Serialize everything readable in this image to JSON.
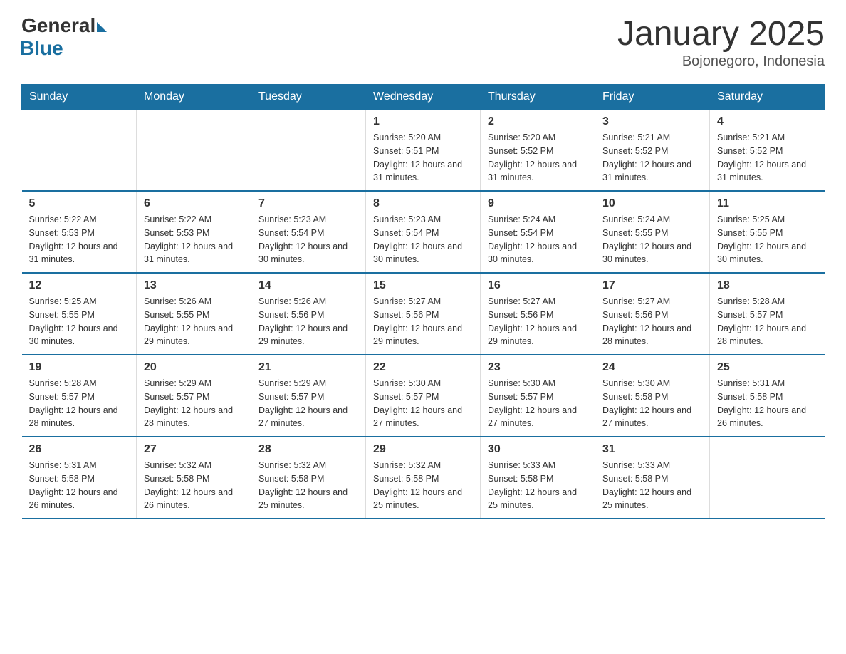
{
  "header": {
    "logo_general": "General",
    "logo_blue": "Blue",
    "month_year": "January 2025",
    "location": "Bojonegoro, Indonesia"
  },
  "days_of_week": [
    "Sunday",
    "Monday",
    "Tuesday",
    "Wednesday",
    "Thursday",
    "Friday",
    "Saturday"
  ],
  "weeks": [
    [
      {
        "day": "",
        "info": ""
      },
      {
        "day": "",
        "info": ""
      },
      {
        "day": "",
        "info": ""
      },
      {
        "day": "1",
        "info": "Sunrise: 5:20 AM\nSunset: 5:51 PM\nDaylight: 12 hours and 31 minutes."
      },
      {
        "day": "2",
        "info": "Sunrise: 5:20 AM\nSunset: 5:52 PM\nDaylight: 12 hours and 31 minutes."
      },
      {
        "day": "3",
        "info": "Sunrise: 5:21 AM\nSunset: 5:52 PM\nDaylight: 12 hours and 31 minutes."
      },
      {
        "day": "4",
        "info": "Sunrise: 5:21 AM\nSunset: 5:52 PM\nDaylight: 12 hours and 31 minutes."
      }
    ],
    [
      {
        "day": "5",
        "info": "Sunrise: 5:22 AM\nSunset: 5:53 PM\nDaylight: 12 hours and 31 minutes."
      },
      {
        "day": "6",
        "info": "Sunrise: 5:22 AM\nSunset: 5:53 PM\nDaylight: 12 hours and 31 minutes."
      },
      {
        "day": "7",
        "info": "Sunrise: 5:23 AM\nSunset: 5:54 PM\nDaylight: 12 hours and 30 minutes."
      },
      {
        "day": "8",
        "info": "Sunrise: 5:23 AM\nSunset: 5:54 PM\nDaylight: 12 hours and 30 minutes."
      },
      {
        "day": "9",
        "info": "Sunrise: 5:24 AM\nSunset: 5:54 PM\nDaylight: 12 hours and 30 minutes."
      },
      {
        "day": "10",
        "info": "Sunrise: 5:24 AM\nSunset: 5:55 PM\nDaylight: 12 hours and 30 minutes."
      },
      {
        "day": "11",
        "info": "Sunrise: 5:25 AM\nSunset: 5:55 PM\nDaylight: 12 hours and 30 minutes."
      }
    ],
    [
      {
        "day": "12",
        "info": "Sunrise: 5:25 AM\nSunset: 5:55 PM\nDaylight: 12 hours and 30 minutes."
      },
      {
        "day": "13",
        "info": "Sunrise: 5:26 AM\nSunset: 5:55 PM\nDaylight: 12 hours and 29 minutes."
      },
      {
        "day": "14",
        "info": "Sunrise: 5:26 AM\nSunset: 5:56 PM\nDaylight: 12 hours and 29 minutes."
      },
      {
        "day": "15",
        "info": "Sunrise: 5:27 AM\nSunset: 5:56 PM\nDaylight: 12 hours and 29 minutes."
      },
      {
        "day": "16",
        "info": "Sunrise: 5:27 AM\nSunset: 5:56 PM\nDaylight: 12 hours and 29 minutes."
      },
      {
        "day": "17",
        "info": "Sunrise: 5:27 AM\nSunset: 5:56 PM\nDaylight: 12 hours and 28 minutes."
      },
      {
        "day": "18",
        "info": "Sunrise: 5:28 AM\nSunset: 5:57 PM\nDaylight: 12 hours and 28 minutes."
      }
    ],
    [
      {
        "day": "19",
        "info": "Sunrise: 5:28 AM\nSunset: 5:57 PM\nDaylight: 12 hours and 28 minutes."
      },
      {
        "day": "20",
        "info": "Sunrise: 5:29 AM\nSunset: 5:57 PM\nDaylight: 12 hours and 28 minutes."
      },
      {
        "day": "21",
        "info": "Sunrise: 5:29 AM\nSunset: 5:57 PM\nDaylight: 12 hours and 27 minutes."
      },
      {
        "day": "22",
        "info": "Sunrise: 5:30 AM\nSunset: 5:57 PM\nDaylight: 12 hours and 27 minutes."
      },
      {
        "day": "23",
        "info": "Sunrise: 5:30 AM\nSunset: 5:57 PM\nDaylight: 12 hours and 27 minutes."
      },
      {
        "day": "24",
        "info": "Sunrise: 5:30 AM\nSunset: 5:58 PM\nDaylight: 12 hours and 27 minutes."
      },
      {
        "day": "25",
        "info": "Sunrise: 5:31 AM\nSunset: 5:58 PM\nDaylight: 12 hours and 26 minutes."
      }
    ],
    [
      {
        "day": "26",
        "info": "Sunrise: 5:31 AM\nSunset: 5:58 PM\nDaylight: 12 hours and 26 minutes."
      },
      {
        "day": "27",
        "info": "Sunrise: 5:32 AM\nSunset: 5:58 PM\nDaylight: 12 hours and 26 minutes."
      },
      {
        "day": "28",
        "info": "Sunrise: 5:32 AM\nSunset: 5:58 PM\nDaylight: 12 hours and 25 minutes."
      },
      {
        "day": "29",
        "info": "Sunrise: 5:32 AM\nSunset: 5:58 PM\nDaylight: 12 hours and 25 minutes."
      },
      {
        "day": "30",
        "info": "Sunrise: 5:33 AM\nSunset: 5:58 PM\nDaylight: 12 hours and 25 minutes."
      },
      {
        "day": "31",
        "info": "Sunrise: 5:33 AM\nSunset: 5:58 PM\nDaylight: 12 hours and 25 minutes."
      },
      {
        "day": "",
        "info": ""
      }
    ]
  ]
}
